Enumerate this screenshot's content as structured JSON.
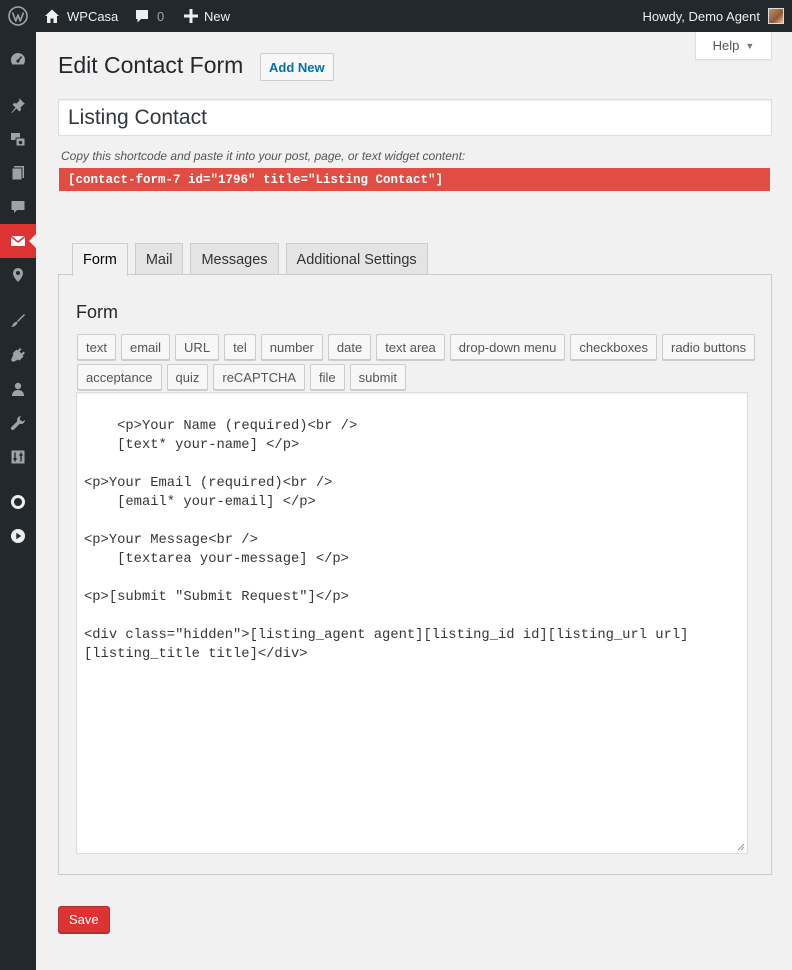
{
  "adminbar": {
    "site_name": "WPCasa",
    "comments_count": "0",
    "new_label": "New",
    "greeting": "Howdy, Demo Agent"
  },
  "sidebar": {
    "items": [
      {
        "icon": "dashboard-icon"
      },
      {
        "icon": "pin-icon"
      },
      {
        "icon": "media-icon"
      },
      {
        "icon": "pages-icon"
      },
      {
        "icon": "comments-icon"
      },
      {
        "icon": "contact-mail-icon",
        "current": true
      },
      {
        "icon": "location-icon"
      },
      {
        "icon": "appearance-icon"
      },
      {
        "icon": "plugins-icon"
      },
      {
        "icon": "users-icon"
      },
      {
        "icon": "tools-icon"
      },
      {
        "icon": "settings-icon"
      },
      {
        "icon": "circle-icon"
      },
      {
        "icon": "play-icon"
      }
    ]
  },
  "help_label": "Help",
  "page_title": "Edit Contact Form",
  "add_new_label": "Add New",
  "form_title_value": "Listing Contact",
  "shortcode_description": "Copy this shortcode and paste it into your post, page, or text widget content:",
  "shortcode": "[contact-form-7 id=\"1796\" title=\"Listing Contact\"]",
  "tabs": [
    "Form",
    "Mail",
    "Messages",
    "Additional Settings"
  ],
  "active_tab": "Form",
  "form_panel": {
    "heading": "Form",
    "tag_buttons_row1": [
      "text",
      "email",
      "URL",
      "tel",
      "number",
      "date",
      "text area",
      "drop-down menu",
      "checkboxes",
      "radio buttons"
    ],
    "tag_buttons_row2": [
      "acceptance",
      "quiz",
      "reCAPTCHA",
      "file",
      "submit"
    ],
    "editor_content": "<p>Your Name (required)<br />\n    [text* your-name] </p>\n\n<p>Your Email (required)<br />\n    [email* your-email] </p>\n\n<p>Your Message<br />\n    [textarea your-message] </p>\n\n<p>[submit \"Submit Request\"]</p>\n\n<div class=\"hidden\">[listing_agent agent][listing_id id][listing_url url]\n[listing_title title]</div>"
  },
  "save_label": "Save",
  "colors": {
    "adminbar_bg": "#23282d",
    "accent_red": "#dd3333",
    "shortcode_bg": "#e14d43",
    "link_blue": "#0073aa"
  }
}
